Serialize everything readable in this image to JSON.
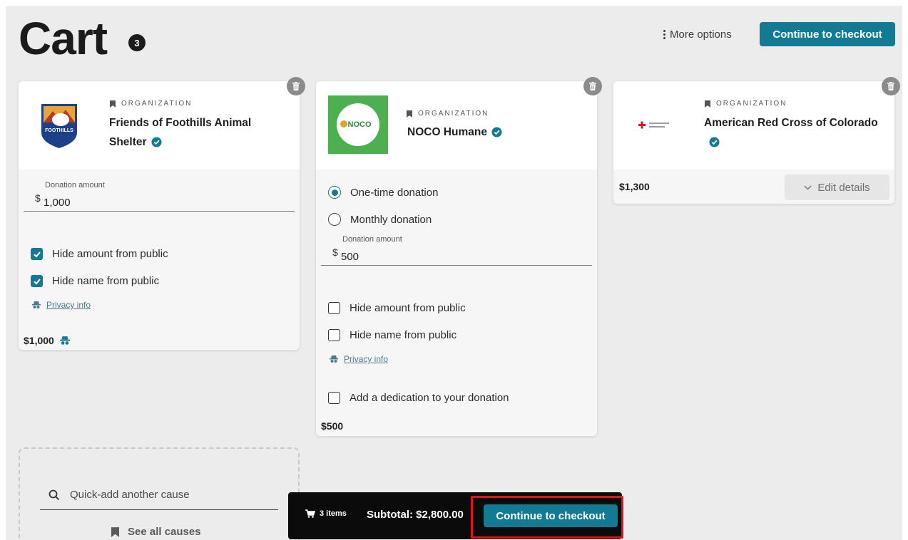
{
  "header": {
    "title": "Cart",
    "item_count": "3",
    "more_options": "More options",
    "checkout_label": "Continue to checkout"
  },
  "cards": [
    {
      "org_label": "ORGANIZATION",
      "name_line1": "Friends of Foothills Animal",
      "name_line2": "Shelter",
      "logo_text": "FOOTHILLS",
      "amount_label": "Donation amount",
      "currency": "$",
      "amount": "1,000",
      "hide_amount": "Hide amount from public",
      "hide_amount_checked": true,
      "hide_name": "Hide name from public",
      "hide_name_checked": true,
      "privacy": "Privacy info",
      "total": "$1,000"
    },
    {
      "org_label": "ORGANIZATION",
      "name": "NOCO Humane",
      "logo_text": "NOCO",
      "one_time": "One-time donation",
      "monthly": "Monthly donation",
      "selected_frequency": "one-time",
      "amount_label": "Donation amount",
      "currency": "$",
      "amount": "500",
      "hide_amount": "Hide amount from public",
      "hide_amount_checked": false,
      "hide_name": "Hide name from public",
      "hide_name_checked": false,
      "privacy": "Privacy info",
      "dedication": "Add a dedication to your donation",
      "total": "$500"
    },
    {
      "org_label": "ORGANIZATION",
      "name": "American Red Cross of Colorado",
      "total": "$1,300",
      "edit_details": "Edit details"
    }
  ],
  "quick_add": {
    "placeholder": "Quick-add another cause",
    "see_all": "See all causes"
  },
  "bottom_bar": {
    "items": "3 items",
    "subtotal": "Subtotal: $2,800.00",
    "checkout_label": "Continue to checkout"
  },
  "colors": {
    "accent": "#137a93",
    "background": "#ececec",
    "highlight": "#e2141b",
    "noco_green": "#4caf50"
  }
}
